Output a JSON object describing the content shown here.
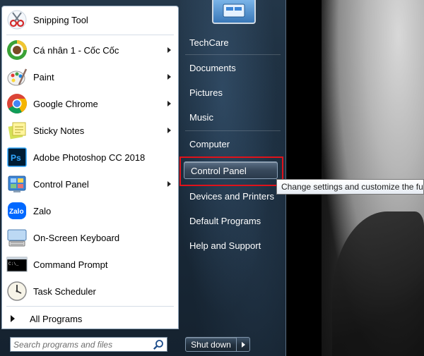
{
  "programs": [
    {
      "label": "Snipping Tool",
      "icon": "scissors-icon",
      "has_submenu": false
    },
    {
      "label": "Cá nhân 1 - Cốc Cốc",
      "icon": "coccoc-browser-icon",
      "has_submenu": true
    },
    {
      "label": "Paint",
      "icon": "paint-palette-icon",
      "has_submenu": true
    },
    {
      "label": "Google Chrome",
      "icon": "chrome-icon",
      "has_submenu": true
    },
    {
      "label": "Sticky Notes",
      "icon": "sticky-notes-icon",
      "has_submenu": true
    },
    {
      "label": "Adobe Photoshop CC 2018",
      "icon": "photoshop-icon",
      "has_submenu": false
    },
    {
      "label": "Control Panel",
      "icon": "control-panel-icon",
      "has_submenu": true
    },
    {
      "label": "Zalo",
      "icon": "zalo-icon",
      "has_submenu": false
    },
    {
      "label": "On-Screen Keyboard",
      "icon": "keyboard-icon",
      "has_submenu": false
    },
    {
      "label": "Command Prompt",
      "icon": "command-prompt-icon",
      "has_submenu": false
    },
    {
      "label": "Task Scheduler",
      "icon": "clock-icon",
      "has_submenu": false
    }
  ],
  "all_programs_label": "All Programs",
  "search": {
    "placeholder": "Search programs and files"
  },
  "right_pane": {
    "items": [
      "TechCare",
      "Documents",
      "Pictures",
      "Music",
      "Computer",
      "Control Panel",
      "Devices and Printers",
      "Default Programs",
      "Help and Support"
    ],
    "highlighted": "Control Panel"
  },
  "tooltip": "Change settings and customize the fun",
  "shutdown_label": "Shut down",
  "colors": {
    "highlight_border": "#e0121a",
    "menu_bg": "#1a2b3b"
  }
}
